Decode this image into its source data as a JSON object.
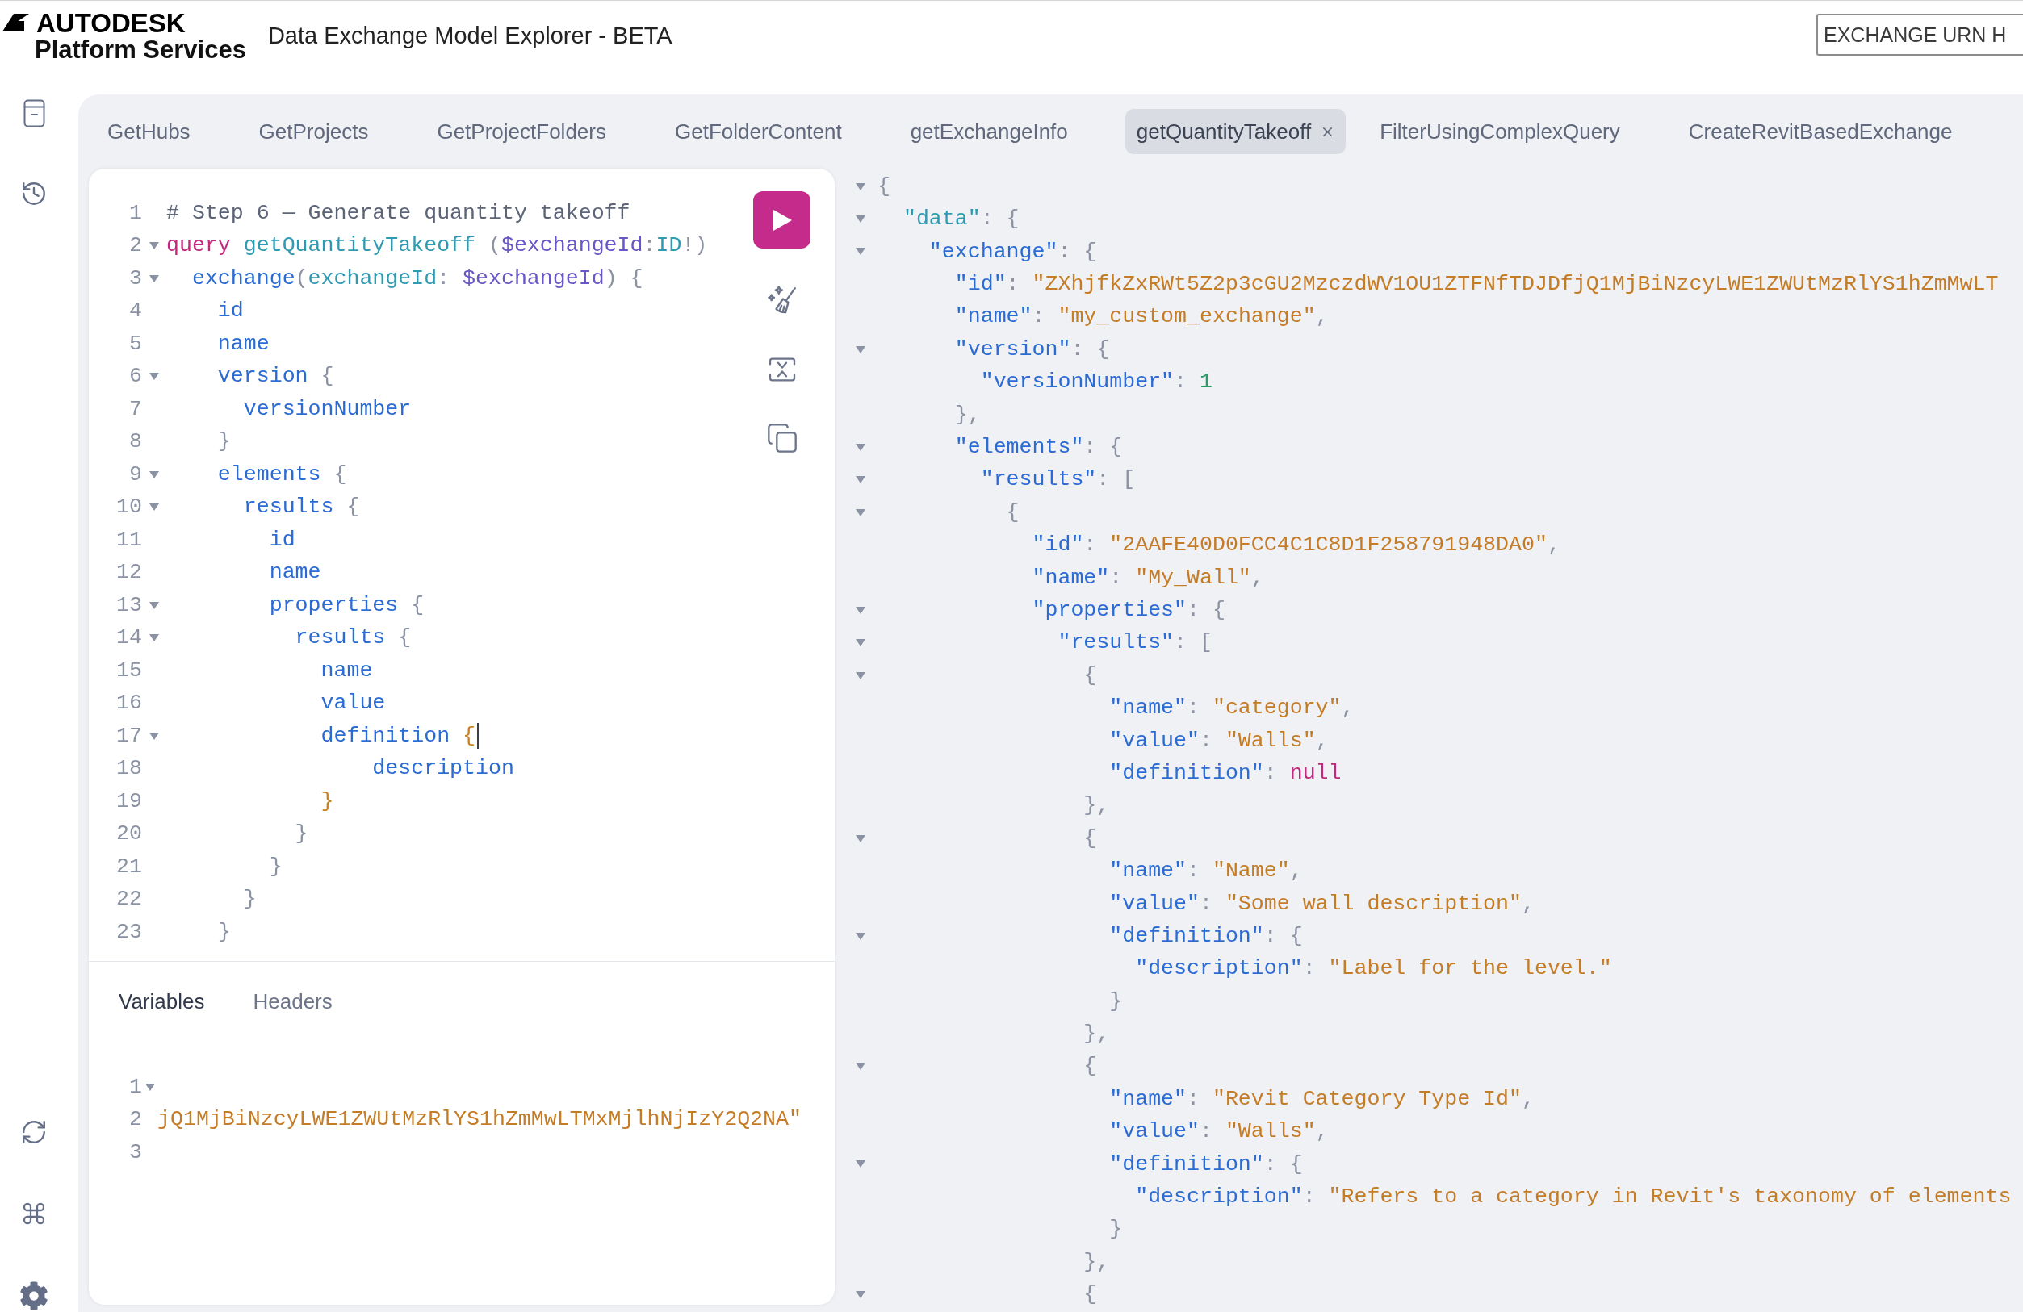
{
  "header": {
    "logo": {
      "wordmark": "AUTODESK",
      "subtitle": "Platform Services"
    },
    "title": "Data Exchange Model Explorer - BETA",
    "urn_field": {
      "placeholder": "EXCHANGE URN H"
    }
  },
  "tabs": [
    {
      "label": "GetHubs",
      "selected": false
    },
    {
      "label": "GetProjects",
      "selected": false
    },
    {
      "label": "GetProjectFolders",
      "selected": false
    },
    {
      "label": "GetFolderContent",
      "selected": false
    },
    {
      "label": "getExchangeInfo",
      "selected": false
    },
    {
      "label": "getQuantityTakeoff",
      "selected": true
    },
    {
      "label": "FilterUsingComplexQuery",
      "selected": false
    },
    {
      "label": "CreateRevitBasedExchange",
      "selected": false
    }
  ],
  "editor": {
    "lines": [
      {
        "number": "1",
        "foldable": false,
        "tokens": [
          {
            "kind": "comment",
            "text": "# Step 6 — Generate quantity takeoff"
          }
        ]
      },
      {
        "number": "2",
        "foldable": true,
        "tokens": [
          {
            "kind": "keyword",
            "text": "query "
          },
          {
            "kind": "def",
            "text": "getQuantityTakeoff "
          },
          {
            "kind": "punct",
            "text": "("
          },
          {
            "kind": "variable",
            "text": "$exchangeId"
          },
          {
            "kind": "punct",
            "text": ":"
          },
          {
            "kind": "type",
            "text": "ID"
          },
          {
            "kind": "punct",
            "text": "!)"
          }
        ]
      },
      {
        "number": "3",
        "foldable": true,
        "tokens": [
          {
            "kind": "field",
            "text": "  exchange"
          },
          {
            "kind": "punct",
            "text": "("
          },
          {
            "kind": "argument",
            "text": "exchangeId"
          },
          {
            "kind": "punct",
            "text": ": "
          },
          {
            "kind": "variable",
            "text": "$exchangeId"
          },
          {
            "kind": "punct",
            "text": ") {"
          }
        ]
      },
      {
        "number": "4",
        "foldable": false,
        "tokens": [
          {
            "kind": "field",
            "text": "    id"
          }
        ]
      },
      {
        "number": "5",
        "foldable": false,
        "tokens": [
          {
            "kind": "field",
            "text": "    name"
          }
        ]
      },
      {
        "number": "6",
        "foldable": true,
        "tokens": [
          {
            "kind": "field",
            "text": "    version "
          },
          {
            "kind": "punct",
            "text": "{"
          }
        ]
      },
      {
        "number": "7",
        "foldable": false,
        "tokens": [
          {
            "kind": "field",
            "text": "      versionNumber"
          }
        ]
      },
      {
        "number": "8",
        "foldable": false,
        "tokens": [
          {
            "kind": "punct",
            "text": "    }"
          }
        ]
      },
      {
        "number": "9",
        "foldable": true,
        "tokens": [
          {
            "kind": "field",
            "text": "    elements "
          },
          {
            "kind": "punct",
            "text": "{"
          }
        ]
      },
      {
        "number": "10",
        "foldable": true,
        "tokens": [
          {
            "kind": "field",
            "text": "      results "
          },
          {
            "kind": "punct",
            "text": "{"
          }
        ]
      },
      {
        "number": "11",
        "foldable": false,
        "tokens": [
          {
            "kind": "field",
            "text": "        id"
          }
        ]
      },
      {
        "number": "12",
        "foldable": false,
        "tokens": [
          {
            "kind": "field",
            "text": "        name"
          }
        ]
      },
      {
        "number": "13",
        "foldable": true,
        "tokens": [
          {
            "kind": "field",
            "text": "        properties "
          },
          {
            "kind": "punct",
            "text": "{"
          }
        ]
      },
      {
        "number": "14",
        "foldable": true,
        "tokens": [
          {
            "kind": "field",
            "text": "          results "
          },
          {
            "kind": "punct",
            "text": "{"
          }
        ]
      },
      {
        "number": "15",
        "foldable": false,
        "tokens": [
          {
            "kind": "field",
            "text": "            name"
          }
        ]
      },
      {
        "number": "16",
        "foldable": false,
        "tokens": [
          {
            "kind": "field",
            "text": "            value"
          }
        ]
      },
      {
        "number": "17",
        "foldable": true,
        "tokens": [
          {
            "kind": "field",
            "text": "            definition "
          },
          {
            "kind": "bracket",
            "text": "{"
          },
          {
            "kind": "cursor"
          }
        ]
      },
      {
        "number": "18",
        "foldable": false,
        "tokens": [
          {
            "kind": "field",
            "text": "                description"
          }
        ]
      },
      {
        "number": "19",
        "foldable": false,
        "tokens": [
          {
            "kind": "bracket",
            "text": "            }"
          }
        ]
      },
      {
        "number": "20",
        "foldable": false,
        "tokens": [
          {
            "kind": "punct",
            "text": "          }"
          }
        ]
      },
      {
        "number": "21",
        "foldable": false,
        "tokens": [
          {
            "kind": "punct",
            "text": "        }"
          }
        ]
      },
      {
        "number": "22",
        "foldable": false,
        "tokens": [
          {
            "kind": "punct",
            "text": "      }"
          }
        ]
      },
      {
        "number": "23",
        "foldable": false,
        "tokens": [
          {
            "kind": "punct",
            "text": "    }"
          }
        ]
      }
    ]
  },
  "editor_tabs": [
    {
      "label": "Variables",
      "selected": true
    },
    {
      "label": "Headers",
      "selected": false
    }
  ],
  "variables": {
    "lines": [
      {
        "number": "1",
        "foldable": true
      },
      {
        "number": "2",
        "foldable": false,
        "tokens": [
          {
            "kind": "string",
            "text": "jQ1MjBiNzcyLWE1ZWUtMzRlYS1hZmMwLTMxMjlhNjIzY2Q2NA\""
          }
        ]
      },
      {
        "number": "3",
        "foldable": false
      }
    ]
  },
  "result": {
    "lines": [
      {
        "foldable": true,
        "tokens": [
          {
            "kind": "punct",
            "text": "{"
          }
        ]
      },
      {
        "foldable": true,
        "tokens": [
          {
            "kind": "def",
            "text": "  \"data\""
          },
          {
            "kind": "punct",
            "text": ": {"
          }
        ]
      },
      {
        "foldable": true,
        "tokens": [
          {
            "kind": "key",
            "text": "    \"exchange\""
          },
          {
            "kind": "punct",
            "text": ": {"
          }
        ]
      },
      {
        "foldable": false,
        "tokens": [
          {
            "kind": "key",
            "text": "      \"id\""
          },
          {
            "kind": "punct",
            "text": ": "
          },
          {
            "kind": "string",
            "text": "\"ZXhjfkZxRWt5Z2p3cGU2MzczdWV1OU1ZTFNfTDJDfjQ1MjBiNzcyLWE1ZWUtMzRlYS1hZmMwLT"
          }
        ]
      },
      {
        "foldable": false,
        "tokens": [
          {
            "kind": "key",
            "text": "      \"name\""
          },
          {
            "kind": "punct",
            "text": ": "
          },
          {
            "kind": "string",
            "text": "\"my_custom_exchange\""
          },
          {
            "kind": "punct",
            "text": ","
          }
        ]
      },
      {
        "foldable": true,
        "tokens": [
          {
            "kind": "key",
            "text": "      \"version\""
          },
          {
            "kind": "punct",
            "text": ": {"
          }
        ]
      },
      {
        "foldable": false,
        "tokens": [
          {
            "kind": "key",
            "text": "        \"versionNumber\""
          },
          {
            "kind": "punct",
            "text": ": "
          },
          {
            "kind": "number",
            "text": "1"
          }
        ]
      },
      {
        "foldable": false,
        "tokens": [
          {
            "kind": "punct",
            "text": "      },"
          }
        ]
      },
      {
        "foldable": true,
        "tokens": [
          {
            "kind": "key",
            "text": "      \"elements\""
          },
          {
            "kind": "punct",
            "text": ": {"
          }
        ]
      },
      {
        "foldable": true,
        "tokens": [
          {
            "kind": "key",
            "text": "        \"results\""
          },
          {
            "kind": "punct",
            "text": ": ["
          }
        ]
      },
      {
        "foldable": true,
        "tokens": [
          {
            "kind": "punct",
            "text": "          {"
          }
        ]
      },
      {
        "foldable": false,
        "tokens": [
          {
            "kind": "key",
            "text": "            \"id\""
          },
          {
            "kind": "punct",
            "text": ": "
          },
          {
            "kind": "string",
            "text": "\"2AAFE40D0FCC4C1C8D1F258791948DA0\""
          },
          {
            "kind": "punct",
            "text": ","
          }
        ]
      },
      {
        "foldable": false,
        "tokens": [
          {
            "kind": "key",
            "text": "            \"name\""
          },
          {
            "kind": "punct",
            "text": ": "
          },
          {
            "kind": "string",
            "text": "\"My_Wall\""
          },
          {
            "kind": "punct",
            "text": ","
          }
        ]
      },
      {
        "foldable": true,
        "tokens": [
          {
            "kind": "key",
            "text": "            \"properties\""
          },
          {
            "kind": "punct",
            "text": ": {"
          }
        ]
      },
      {
        "foldable": true,
        "tokens": [
          {
            "kind": "key",
            "text": "              \"results\""
          },
          {
            "kind": "punct",
            "text": ": ["
          }
        ]
      },
      {
        "foldable": true,
        "tokens": [
          {
            "kind": "punct",
            "text": "                {"
          }
        ]
      },
      {
        "foldable": false,
        "tokens": [
          {
            "kind": "key",
            "text": "                  \"name\""
          },
          {
            "kind": "punct",
            "text": ": "
          },
          {
            "kind": "string",
            "text": "\"category\""
          },
          {
            "kind": "punct",
            "text": ","
          }
        ]
      },
      {
        "foldable": false,
        "tokens": [
          {
            "kind": "key",
            "text": "                  \"value\""
          },
          {
            "kind": "punct",
            "text": ": "
          },
          {
            "kind": "string",
            "text": "\"Walls\""
          },
          {
            "kind": "punct",
            "text": ","
          }
        ]
      },
      {
        "foldable": false,
        "tokens": [
          {
            "kind": "key",
            "text": "                  \"definition\""
          },
          {
            "kind": "punct",
            "text": ": "
          },
          {
            "kind": "null",
            "text": "null"
          }
        ]
      },
      {
        "foldable": false,
        "tokens": [
          {
            "kind": "punct",
            "text": "                },"
          }
        ]
      },
      {
        "foldable": true,
        "tokens": [
          {
            "kind": "punct",
            "text": "                {"
          }
        ]
      },
      {
        "foldable": false,
        "tokens": [
          {
            "kind": "key",
            "text": "                  \"name\""
          },
          {
            "kind": "punct",
            "text": ": "
          },
          {
            "kind": "string",
            "text": "\"Name\""
          },
          {
            "kind": "punct",
            "text": ","
          }
        ]
      },
      {
        "foldable": false,
        "tokens": [
          {
            "kind": "key",
            "text": "                  \"value\""
          },
          {
            "kind": "punct",
            "text": ": "
          },
          {
            "kind": "string",
            "text": "\"Some wall description\""
          },
          {
            "kind": "punct",
            "text": ","
          }
        ]
      },
      {
        "foldable": true,
        "tokens": [
          {
            "kind": "key",
            "text": "                  \"definition\""
          },
          {
            "kind": "punct",
            "text": ": {"
          }
        ]
      },
      {
        "foldable": false,
        "tokens": [
          {
            "kind": "key",
            "text": "                    \"description\""
          },
          {
            "kind": "punct",
            "text": ": "
          },
          {
            "kind": "string",
            "text": "\"Label for the level.\""
          }
        ]
      },
      {
        "foldable": false,
        "tokens": [
          {
            "kind": "punct",
            "text": "                  }"
          }
        ]
      },
      {
        "foldable": false,
        "tokens": [
          {
            "kind": "punct",
            "text": "                },"
          }
        ]
      },
      {
        "foldable": true,
        "tokens": [
          {
            "kind": "punct",
            "text": "                {"
          }
        ]
      },
      {
        "foldable": false,
        "tokens": [
          {
            "kind": "key",
            "text": "                  \"name\""
          },
          {
            "kind": "punct",
            "text": ": "
          },
          {
            "kind": "string",
            "text": "\"Revit Category Type Id\""
          },
          {
            "kind": "punct",
            "text": ","
          }
        ]
      },
      {
        "foldable": false,
        "tokens": [
          {
            "kind": "key",
            "text": "                  \"value\""
          },
          {
            "kind": "punct",
            "text": ": "
          },
          {
            "kind": "string",
            "text": "\"Walls\""
          },
          {
            "kind": "punct",
            "text": ","
          }
        ]
      },
      {
        "foldable": true,
        "tokens": [
          {
            "kind": "key",
            "text": "                  \"definition\""
          },
          {
            "kind": "punct",
            "text": ": {"
          }
        ]
      },
      {
        "foldable": false,
        "tokens": [
          {
            "kind": "key",
            "text": "                    \"description\""
          },
          {
            "kind": "punct",
            "text": ": "
          },
          {
            "kind": "string",
            "text": "\"Refers to a category in Revit's taxonomy of elements"
          }
        ]
      },
      {
        "foldable": false,
        "tokens": [
          {
            "kind": "punct",
            "text": "                  }"
          }
        ]
      },
      {
        "foldable": false,
        "tokens": [
          {
            "kind": "punct",
            "text": "                },"
          }
        ]
      },
      {
        "foldable": true,
        "tokens": [
          {
            "kind": "punct",
            "text": "                {"
          }
        ]
      }
    ]
  }
}
